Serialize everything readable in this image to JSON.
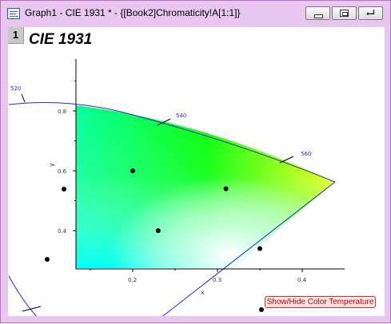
{
  "window": {
    "title": "Graph1 - CIE 1931 * - {[Book2]Chromaticity!A[1:1]}",
    "layer_number": "1",
    "graph_title": "CIE 1931",
    "toggle_button": "Show/Hide Color Temperature"
  },
  "icons": [
    "app-graph-icon",
    "minimize-icon",
    "maximize-icon",
    "restore-icon"
  ],
  "colors": {
    "window_frame": "#e9c6ef",
    "locus_line": "#2828c8",
    "toggle_text": "#c00000"
  },
  "chart_data": {
    "type": "scatter",
    "title": "CIE 1931",
    "xlabel": "x",
    "ylabel": "y",
    "x_ticks": [
      "0.2",
      "0.3",
      "0.4"
    ],
    "y_ticks": [
      "0.4",
      "0.6",
      "0.8"
    ],
    "xlim": [
      0.13,
      0.44
    ],
    "ylim": [
      0.33,
      0.95
    ],
    "wavelength_labels": [
      "520",
      "540",
      "560"
    ],
    "series": [
      {
        "values": [
          {
            "x": 0.2,
            "y": 0.6
          },
          {
            "x": 0.31,
            "y": 0.54
          },
          {
            "x": 0.23,
            "y": 0.4
          },
          {
            "x": 0.35,
            "y": 0.34
          }
        ]
      }
    ]
  }
}
